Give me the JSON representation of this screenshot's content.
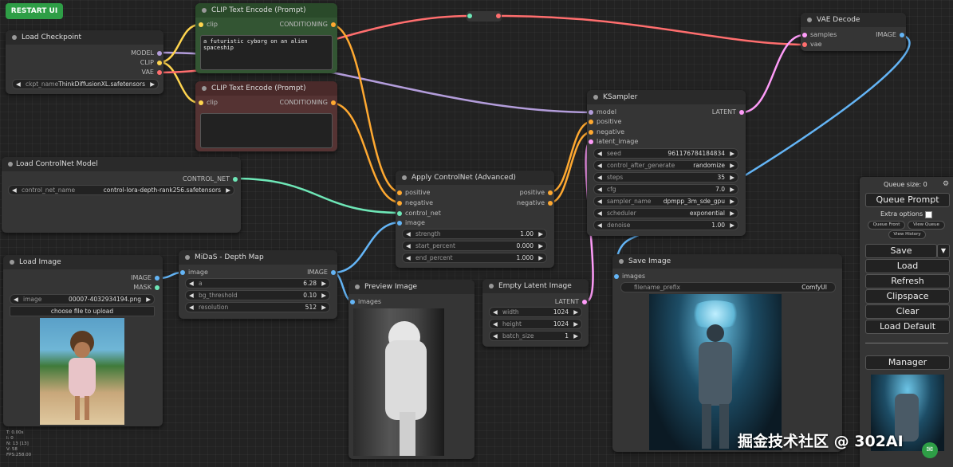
{
  "toolbar": {
    "restart_label": "RESTART UI"
  },
  "nodes": {
    "load_checkpoint": {
      "title": "Load Checkpoint",
      "outputs": [
        "MODEL",
        "CLIP",
        "VAE"
      ],
      "widget_label": "ckpt_name",
      "widget_value": "ThinkDiffusionXL.safetensors"
    },
    "clip_pos": {
      "title": "CLIP Text Encode (Prompt)",
      "input": "clip",
      "output": "CONDITIONING",
      "text": "a futuristic cyborg on an alien spaceship"
    },
    "clip_neg": {
      "title": "CLIP Text Encode (Prompt)",
      "input": "clip",
      "output": "CONDITIONING"
    },
    "load_controlnet": {
      "title": "Load ControlNet Model",
      "output": "CONTROL_NET",
      "widget_label": "control_net_name",
      "widget_value": "control-lora-depth-rank256.safetensors"
    },
    "apply_controlnet": {
      "title": "Apply ControlNet (Advanced)",
      "inputs": [
        "positive",
        "negative",
        "control_net",
        "image"
      ],
      "outputs": [
        "positive",
        "negative"
      ],
      "widgets": [
        {
          "label": "strength",
          "value": "1.00"
        },
        {
          "label": "start_percent",
          "value": "0.000"
        },
        {
          "label": "end_percent",
          "value": "1.000"
        }
      ]
    },
    "ksampler": {
      "title": "KSampler",
      "inputs": [
        "model",
        "positive",
        "negative",
        "latent_image"
      ],
      "output": "LATENT",
      "widgets": [
        {
          "label": "seed",
          "value": "961176784184834"
        },
        {
          "label": "control_after_generate",
          "value": "randomize"
        },
        {
          "label": "steps",
          "value": "35"
        },
        {
          "label": "cfg",
          "value": "7.0"
        },
        {
          "label": "sampler_name",
          "value": "dpmpp_3m_sde_gpu"
        },
        {
          "label": "scheduler",
          "value": "exponential"
        },
        {
          "label": "denoise",
          "value": "1.00"
        }
      ]
    },
    "vae_decode": {
      "title": "VAE Decode",
      "inputs": [
        "samples",
        "vae"
      ],
      "output": "IMAGE"
    },
    "load_image": {
      "title": "Load Image",
      "outputs": [
        "IMAGE",
        "MASK"
      ],
      "widget_label": "image",
      "widget_value": "00007-4032934194.png",
      "upload_label": "choose file to upload"
    },
    "midas": {
      "title": "MiDaS - Depth Map",
      "input": "image",
      "output": "IMAGE",
      "widgets": [
        {
          "label": "a",
          "value": "6.28"
        },
        {
          "label": "bg_threshold",
          "value": "0.10"
        },
        {
          "label": "resolution",
          "value": "512"
        }
      ]
    },
    "preview_image": {
      "title": "Preview Image",
      "input": "images"
    },
    "empty_latent": {
      "title": "Empty Latent Image",
      "output": "LATENT",
      "widgets": [
        {
          "label": "width",
          "value": "1024"
        },
        {
          "label": "height",
          "value": "1024"
        },
        {
          "label": "batch_size",
          "value": "1"
        }
      ]
    },
    "save_image": {
      "title": "Save Image",
      "input": "images",
      "widget_label": "filename_prefix",
      "widget_value": "ComfyUI"
    }
  },
  "queue": {
    "size_label": "Queue size: 0",
    "queue_prompt": "Queue Prompt",
    "extra_options": "Extra options",
    "queue_front": "Queue Front",
    "view_queue": "View Queue",
    "view_history": "View History",
    "save": "Save",
    "load": "Load",
    "refresh": "Refresh",
    "clipspace": "Clipspace",
    "clear": "Clear",
    "load_default": "Load Default",
    "manager": "Manager"
  },
  "stats": [
    "T: 0.00s",
    "I: 0",
    "N: 13 [13]",
    "V: 58",
    "FPS:258.00"
  ],
  "watermark": "掘金技术社区 @ 302AI",
  "colors": {
    "model": "#b39ddb",
    "clip": "#ffd54f",
    "vae": "#ff6e6e",
    "conditioning": "#ffa931",
    "control_net": "#6ee7b7",
    "image": "#64b5f6",
    "latent": "#ff9cf9"
  }
}
